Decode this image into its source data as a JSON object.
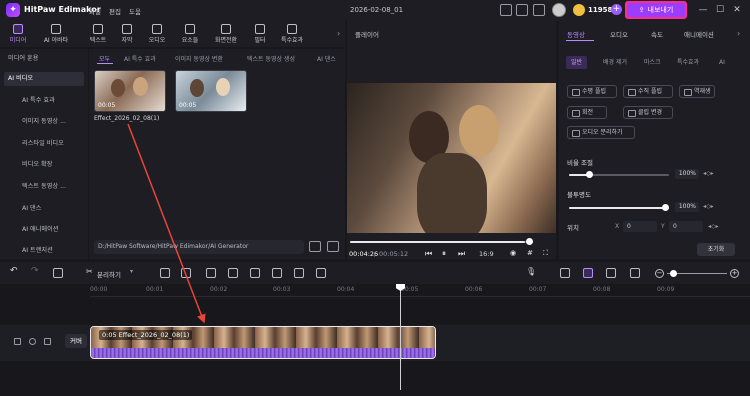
{
  "app": {
    "title": "HitPaw Edimakor",
    "menu": [
      "파일",
      "편집",
      "도움"
    ],
    "document_title": "2026-02-08_01",
    "coins": "11958",
    "export_label": "내보내기",
    "accent": "#9b3cff",
    "highlight": "#ff2d8a"
  },
  "toolbar": {
    "tools": [
      {
        "label": "미디어",
        "icon": "media-icon",
        "active": true
      },
      {
        "label": "AI 아바타",
        "icon": "avatar-icon"
      },
      {
        "label": "텍스트",
        "icon": "text-icon"
      },
      {
        "label": "자막",
        "icon": "subtitle-icon"
      },
      {
        "label": "오디오",
        "icon": "music-icon"
      },
      {
        "label": "요소들",
        "icon": "elements-icon"
      },
      {
        "label": "화면전환",
        "icon": "transition-icon"
      },
      {
        "label": "필터",
        "icon": "filter-icon"
      },
      {
        "label": "특수효과",
        "icon": "effects-icon"
      }
    ]
  },
  "sidebar": {
    "items": [
      "미디어 훈용",
      "AI 비디오",
      "AI 특수 효과",
      "이미지 동영상 ...",
      "리스타일 비디오",
      "비디오 확장",
      "텍스트 동영상 ...",
      "AI 댄스",
      "AI 애니메이션",
      "AI 트랜지션"
    ]
  },
  "media": {
    "tabs": [
      "모두",
      "AI 특수 효과",
      "이미지 동영상 변환",
      "텍스트 동영상 생성",
      "AI 댄스"
    ],
    "thumbs": [
      {
        "duration": "00:05"
      },
      {
        "duration": "00:05"
      }
    ],
    "thumb_label": "Effect_2026_02_08(1)",
    "path": "D:/HitPaw Software/HitPaw Edimakor/AI Generator"
  },
  "player": {
    "title": "플레이어",
    "time_current": "00:04:26",
    "time_total": "00:05:12",
    "progress": 0.97,
    "ratio": "16:9"
  },
  "right_panel": {
    "tabs": [
      "동영상",
      "오디오",
      "속도",
      "애니메이션"
    ],
    "subtabs": [
      "일반",
      "배경 제거",
      "마스크",
      "특수효과",
      "AI"
    ],
    "buttons": [
      "수평 플립",
      "수직 플립",
      "역재생",
      "회전",
      "클립 변경",
      "오디오 분리하기"
    ],
    "opacity_label": "비율 조절",
    "opacity_value": "100%",
    "opacity": 1.0,
    "blend_label": "불투명도",
    "blend_value": "100%",
    "blend": 1.0,
    "position_label": "위치",
    "pos_x_label": "X",
    "pos_x": "0",
    "pos_y_label": "Y",
    "pos_y": "0",
    "reset_label": "초기화"
  },
  "timeline": {
    "split_label": "분리하기",
    "ticks": [
      "00:00",
      "00:01",
      "00:02",
      "00:03",
      "00:04",
      "00:05",
      "00:06",
      "00:07",
      "00:08",
      "00:09"
    ],
    "track_label": "커버",
    "clip_title": "0:05 Effect_2026_02_08(1)"
  }
}
